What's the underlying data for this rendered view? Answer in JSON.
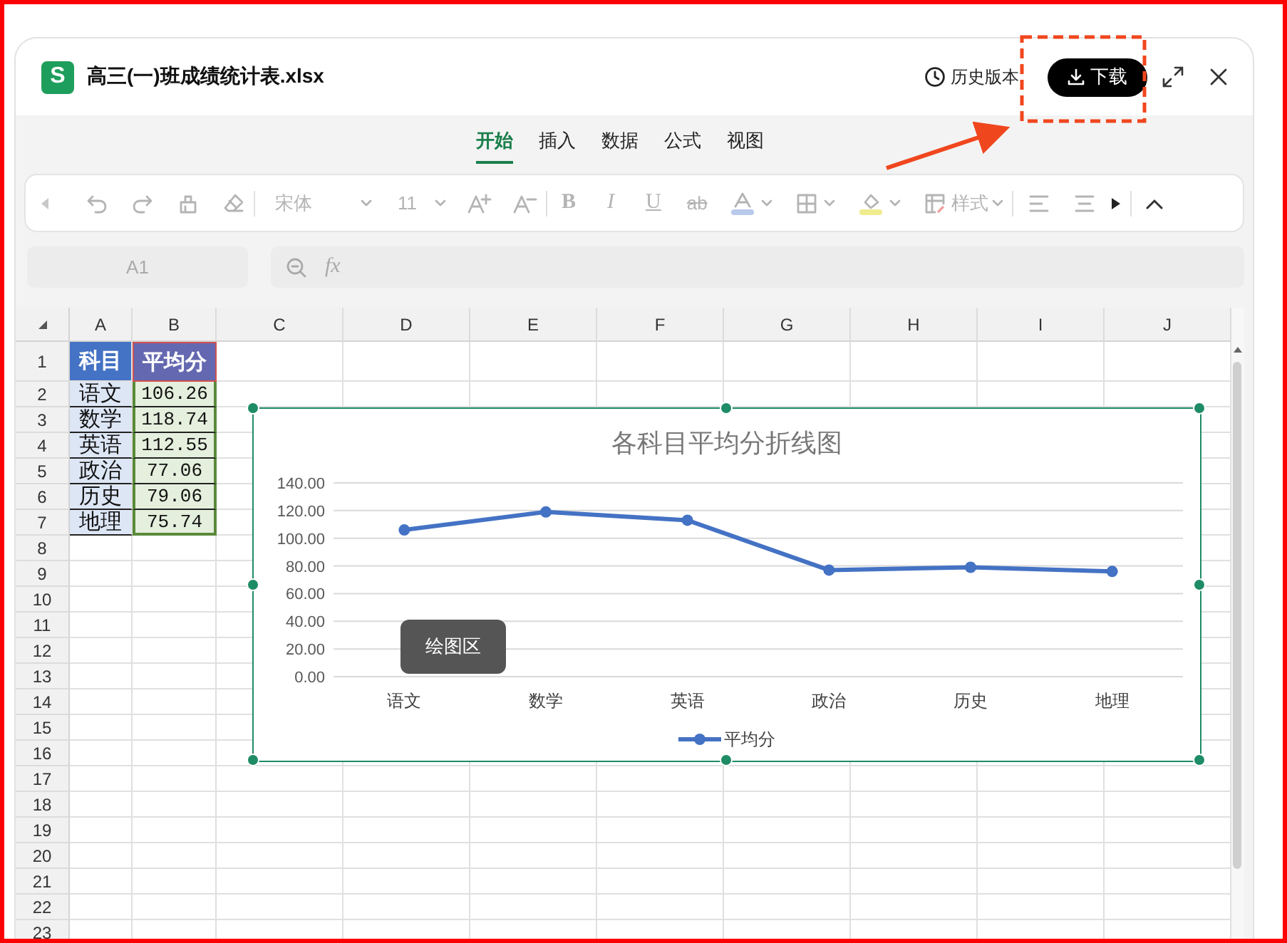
{
  "window": {
    "app_icon_letter": "S",
    "title": "高三(一)班成绩统计表.xlsx",
    "history_button": "历史版本",
    "download_button": "下载"
  },
  "ribbon_tabs": [
    {
      "label": "开始",
      "selected": true
    },
    {
      "label": "插入",
      "selected": false
    },
    {
      "label": "数据",
      "selected": false
    },
    {
      "label": "公式",
      "selected": false
    },
    {
      "label": "视图",
      "selected": false
    }
  ],
  "toolbar": {
    "font": "宋体",
    "font_size": "11",
    "bold": "B",
    "italic": "I",
    "underline": "U",
    "strikethrough": "ab",
    "style_menu": "样式"
  },
  "formula_bar": {
    "cell_ref": "A1",
    "fx": "fx"
  },
  "sheet": {
    "columns": [
      "A",
      "B",
      "C",
      "D",
      "E",
      "F",
      "G",
      "H",
      "I",
      "J"
    ],
    "row_numbers": [
      "1",
      "2",
      "3",
      "4",
      "5",
      "6",
      "7",
      "8",
      "9",
      "10",
      "11",
      "12",
      "13",
      "14",
      "15",
      "16",
      "17",
      "18",
      "19",
      "20",
      "21",
      "22",
      "23"
    ],
    "table": {
      "header": [
        "科目",
        "平均分"
      ],
      "rows": [
        [
          "语文",
          "106.26"
        ],
        [
          "数学",
          "118.74"
        ],
        [
          "英语",
          "112.55"
        ],
        [
          "政治",
          "77.06"
        ],
        [
          "历史",
          "79.06"
        ],
        [
          "地理",
          "75.74"
        ]
      ]
    },
    "chart": {
      "tooltip": "绘图区",
      "chart_data": {
        "type": "line",
        "title": "各科目平均分折线图",
        "categories": [
          "语文",
          "数学",
          "英语",
          "政治",
          "历史",
          "地理"
        ],
        "grid": true,
        "series": [
          {
            "name": "平均分",
            "color": "#4472c4",
            "marker": true,
            "values": [
              106,
              119,
              113,
              77,
              79,
              76
            ]
          }
        ],
        "ylim": [
          0,
          140
        ],
        "yticks": [
          {
            "value": 0,
            "label": "0.00"
          },
          {
            "value": 20,
            "label": "20.00"
          },
          {
            "value": 40,
            "label": "40.00"
          },
          {
            "value": 60,
            "label": "60.00"
          },
          {
            "value": 80,
            "label": "80.00"
          },
          {
            "value": 100,
            "label": "100.00"
          },
          {
            "value": 120,
            "label": "120.00"
          },
          {
            "value": 140,
            "label": "140.00"
          }
        ]
      }
    }
  }
}
